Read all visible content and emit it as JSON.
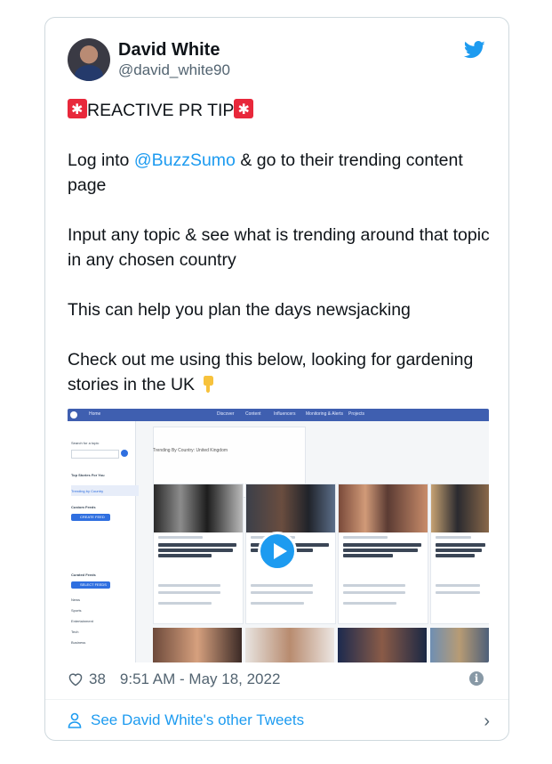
{
  "author": {
    "name": "David White",
    "handle": "@david_white90"
  },
  "tweet": {
    "tip": "REACTIVE PR TIP",
    "p1_before": "Log into ",
    "p1_mention": "@BuzzSumo",
    "p1_after": " & go to their trending content page",
    "p2": "Input any topic & see what is trending around that topic in any chosen country",
    "p3": "This can help you plan the days newsjacking",
    "p4": "Check out me using this below, looking for gardening stories in the UK"
  },
  "media": {
    "nav": [
      "Home",
      "Discover",
      "Content",
      "Influencers",
      "Monitoring & Alerts",
      "Projects"
    ],
    "sidebar": [
      "Search for a topic",
      "Top Stories For You",
      "Trending by Country",
      "Custom Feeds",
      "Curated Feeds",
      "News",
      "Sports",
      "Entertainment",
      "Tech",
      "Business"
    ],
    "sidebar_button_1": "CREATE FEED",
    "sidebar_button_2": "SELECT FEEDS",
    "strip": "Trending By Country: United Kingdom",
    "tiles": [
      {
        "source": "dailymail.co.uk",
        "headline": "Emotional night at Juventus who bid farewell to Giorgio Chiellini and distraught Paulo Dybala"
      },
      {
        "source": "dailymail.co.uk",
        "headline": "Jurgen Klopp says Liverpool ARE interested in Kylian Mbappe"
      },
      {
        "source": "dailymail.co.uk",
        "headline": "Johnny Depp's lawyer grill Amber Heard over photos looking fresh-faced after alleged abuse"
      },
      {
        "source": "dailymail.co.uk",
        "headline": "Sweden officially signs NATO application as Putin shows weakening resolve"
      }
    ],
    "trending_label": "Trending Score",
    "engagement_label": "Engagement"
  },
  "meta": {
    "likes": "38",
    "time": "9:51 AM - May 18, 2022"
  },
  "footer": {
    "link": "See David White's other Tweets"
  },
  "colors": {
    "accent": "#1d9bf0",
    "muted": "#536471",
    "border": "#cfd9de"
  }
}
